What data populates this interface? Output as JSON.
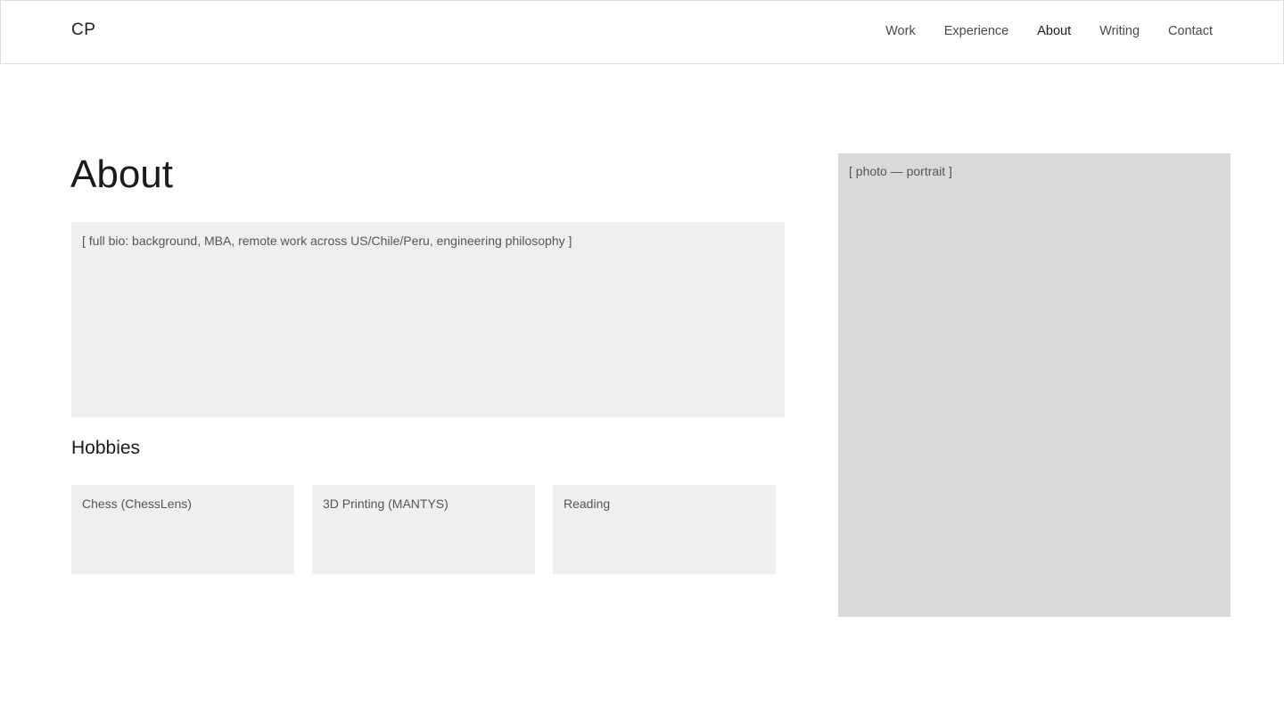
{
  "header": {
    "logo": "CP",
    "nav": [
      "Work",
      "Experience",
      "About",
      "Writing",
      "Contact"
    ],
    "active_nav": "About"
  },
  "main": {
    "title": "About",
    "bio_placeholder": "[ full bio: background, MBA, remote work across US/Chile/Peru, engineering philosophy ]",
    "hobbies_title": "Hobbies",
    "hobbies": [
      "Chess (ChessLens)",
      "3D Printing (MANTYS)",
      "Reading"
    ]
  },
  "sidebar": {
    "photo_placeholder": "[ photo — portrait ]"
  },
  "colors": {
    "placeholder_bg": "#efefef",
    "photo_bg": "#d9d9d9",
    "text": "#1a1a1a"
  }
}
